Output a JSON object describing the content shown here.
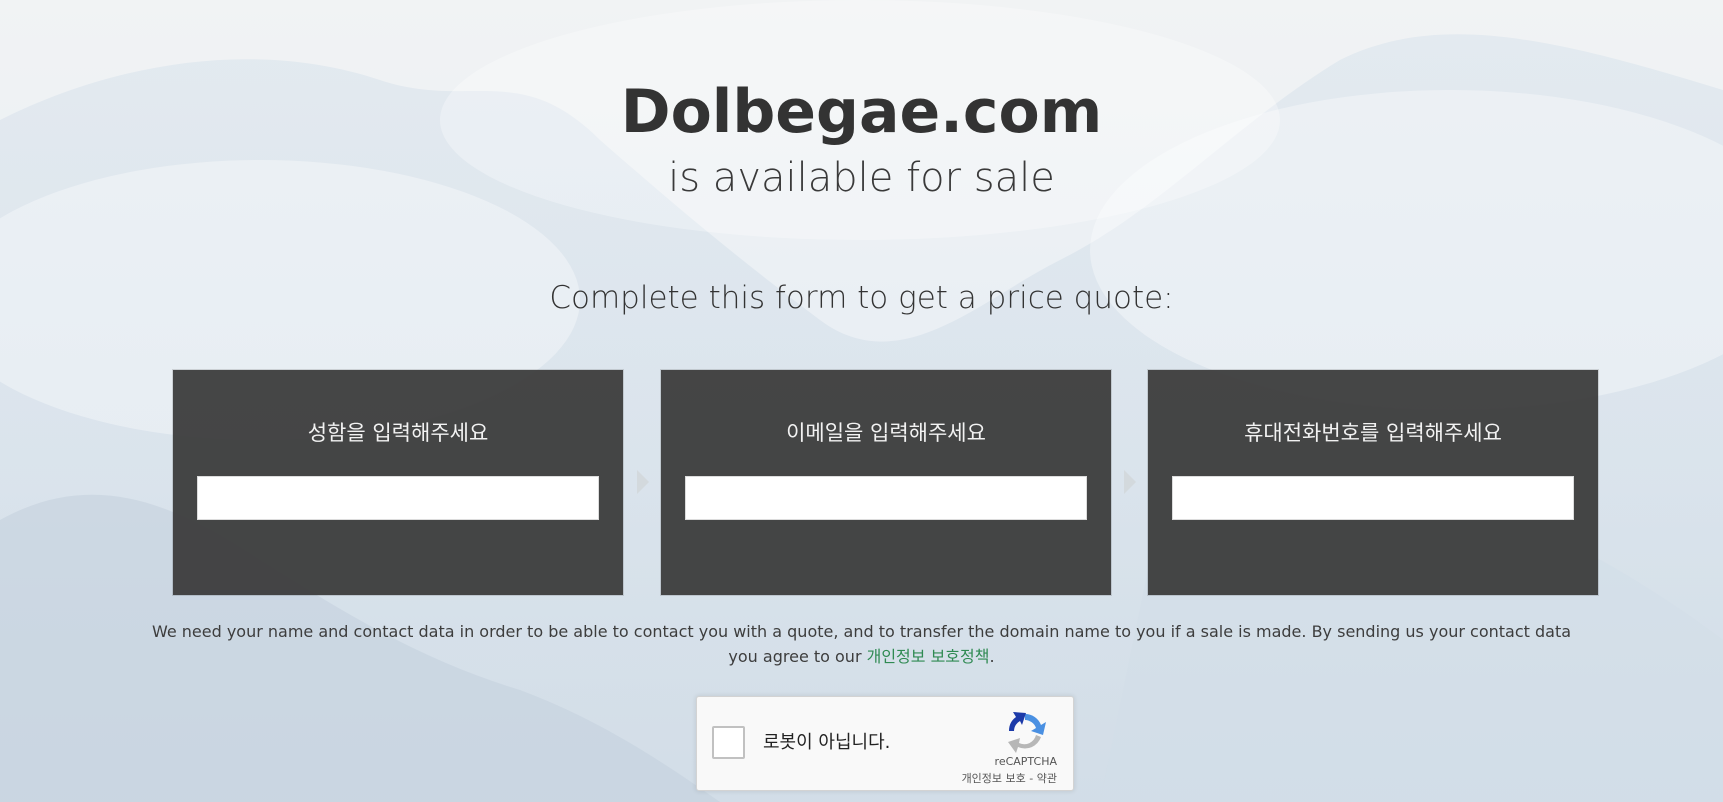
{
  "header": {
    "domain": "Dolbegae.com",
    "availability": "is available for sale"
  },
  "form": {
    "heading": "Complete this form to get a price quote:",
    "fields": [
      {
        "label": "성함을 입력해주세요",
        "value": "",
        "placeholder": ""
      },
      {
        "label": "이메일을 입력해주세요",
        "value": "",
        "placeholder": ""
      },
      {
        "label": "휴대전화번호를 입력해주세요",
        "value": "",
        "placeholder": ""
      }
    ],
    "step_arrow_icon": "chevron-right-icon"
  },
  "notice": {
    "text": "We need your name and contact data in order to be able to contact you with a quote, and to transfer the domain name to you if a sale is made. By sending us your contact data you agree to our ",
    "link_label": "개인정보 보호정책",
    "suffix": "."
  },
  "recaptcha": {
    "label": "로봇이 아닙니다.",
    "brand": "reCAPTCHA",
    "privacy_label": "개인정보 보호",
    "separator": " - ",
    "terms_label": "약관",
    "logo_icon": "recaptcha-logo-icon"
  },
  "colors": {
    "panel_bg": "#3c3c3c",
    "link": "#2f8a52",
    "title": "#333333",
    "background": "#e7edf3"
  }
}
